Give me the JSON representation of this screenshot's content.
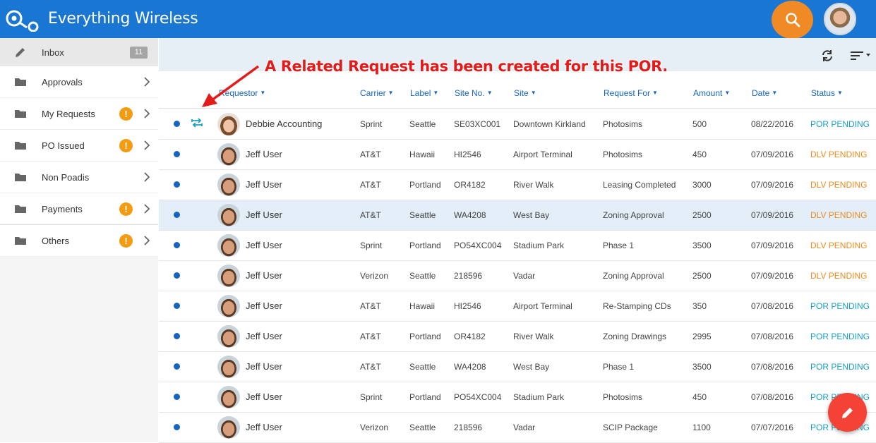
{
  "app": {
    "title": "Everything Wireless"
  },
  "colors": {
    "brand": "#1976d2",
    "search": "#f08a24",
    "fab": "#f44336",
    "por": "#1aa0c8",
    "dlv": "#ef8c1c",
    "header_link": "#1565c0"
  },
  "sidebar": {
    "items": [
      {
        "label": "Inbox",
        "icon": "pencil-icon",
        "count": "11"
      },
      {
        "label": "Approvals",
        "icon": "folder-icon"
      },
      {
        "label": "My Requests",
        "icon": "folder-icon",
        "alert": "!"
      },
      {
        "label": "PO Issued",
        "icon": "folder-icon",
        "alert": "!"
      },
      {
        "label": "Non Poadis",
        "icon": "folder-icon"
      },
      {
        "label": "Payments",
        "icon": "folder-icon",
        "alert": "!"
      },
      {
        "label": "Others",
        "icon": "folder-icon",
        "alert": "!"
      }
    ]
  },
  "annotation": {
    "text": "A Related Request has been created for this POR."
  },
  "table": {
    "headers": {
      "requestor": "Requestor",
      "carrier": "Carrier",
      "label": "Label",
      "site_no": "Site No.",
      "site": "Site",
      "request_for": "Request For",
      "amount": "Amount",
      "date": "Date",
      "status": "Status"
    },
    "rows": [
      {
        "name": "Debbie Accounting",
        "carrier": "Sprint",
        "label": "Seattle",
        "site_no": "SE03XC001",
        "site": "Downtown Kirkland",
        "request_for": "Photosims",
        "amount": "500",
        "date": "08/22/2016",
        "status": "POR PENDING"
      },
      {
        "name": "Jeff User",
        "carrier": "AT&T",
        "label": "Hawaii",
        "site_no": "HI2546",
        "site": "Airport Terminal",
        "request_for": "Photosims",
        "amount": "450",
        "date": "07/09/2016",
        "status": "DLV PENDING"
      },
      {
        "name": "Jeff User",
        "carrier": "AT&T",
        "label": "Portland",
        "site_no": "OR4182",
        "site": "River Walk",
        "request_for": "Leasing Completed",
        "amount": "3000",
        "date": "07/09/2016",
        "status": "DLV PENDING"
      },
      {
        "name": "Jeff User",
        "carrier": "AT&T",
        "label": "Seattle",
        "site_no": "WA4208",
        "site": "West Bay",
        "request_for": "Zoning Approval",
        "amount": "2500",
        "date": "07/09/2016",
        "status": "DLV PENDING"
      },
      {
        "name": "Jeff User",
        "carrier": "Sprint",
        "label": "Portland",
        "site_no": "PO54XC004",
        "site": "Stadium Park",
        "request_for": "Phase 1",
        "amount": "3500",
        "date": "07/09/2016",
        "status": "DLV PENDING"
      },
      {
        "name": "Jeff User",
        "carrier": "Verizon",
        "label": "Seattle",
        "site_no": "218596",
        "site": "Vadar",
        "request_for": "Zoning Approval",
        "amount": "2500",
        "date": "07/09/2016",
        "status": "DLV PENDING"
      },
      {
        "name": "Jeff User",
        "carrier": "AT&T",
        "label": "Hawaii",
        "site_no": "HI2546",
        "site": "Airport Terminal",
        "request_for": "Re-Stamping CDs",
        "amount": "350",
        "date": "07/08/2016",
        "status": "POR PENDING"
      },
      {
        "name": "Jeff User",
        "carrier": "AT&T",
        "label": "Portland",
        "site_no": "OR4182",
        "site": "River Walk",
        "request_for": "Zoning Drawings",
        "amount": "2995",
        "date": "07/08/2016",
        "status": "POR PENDING"
      },
      {
        "name": "Jeff User",
        "carrier": "AT&T",
        "label": "Seattle",
        "site_no": "WA4208",
        "site": "West Bay",
        "request_for": "Phase 1",
        "amount": "3500",
        "date": "07/08/2016",
        "status": "POR PENDING"
      },
      {
        "name": "Jeff User",
        "carrier": "Sprint",
        "label": "Portland",
        "site_no": "PO54XC004",
        "site": "Stadium Park",
        "request_for": "Photosims",
        "amount": "450",
        "date": "07/08/2016",
        "status": "POR PENDING"
      },
      {
        "name": "Jeff User",
        "carrier": "Verizon",
        "label": "Seattle",
        "site_no": "218596",
        "site": "Vadar",
        "request_for": "SCIP Package",
        "amount": "1100",
        "date": "07/07/2016",
        "status": "POR PENDING"
      }
    ]
  }
}
